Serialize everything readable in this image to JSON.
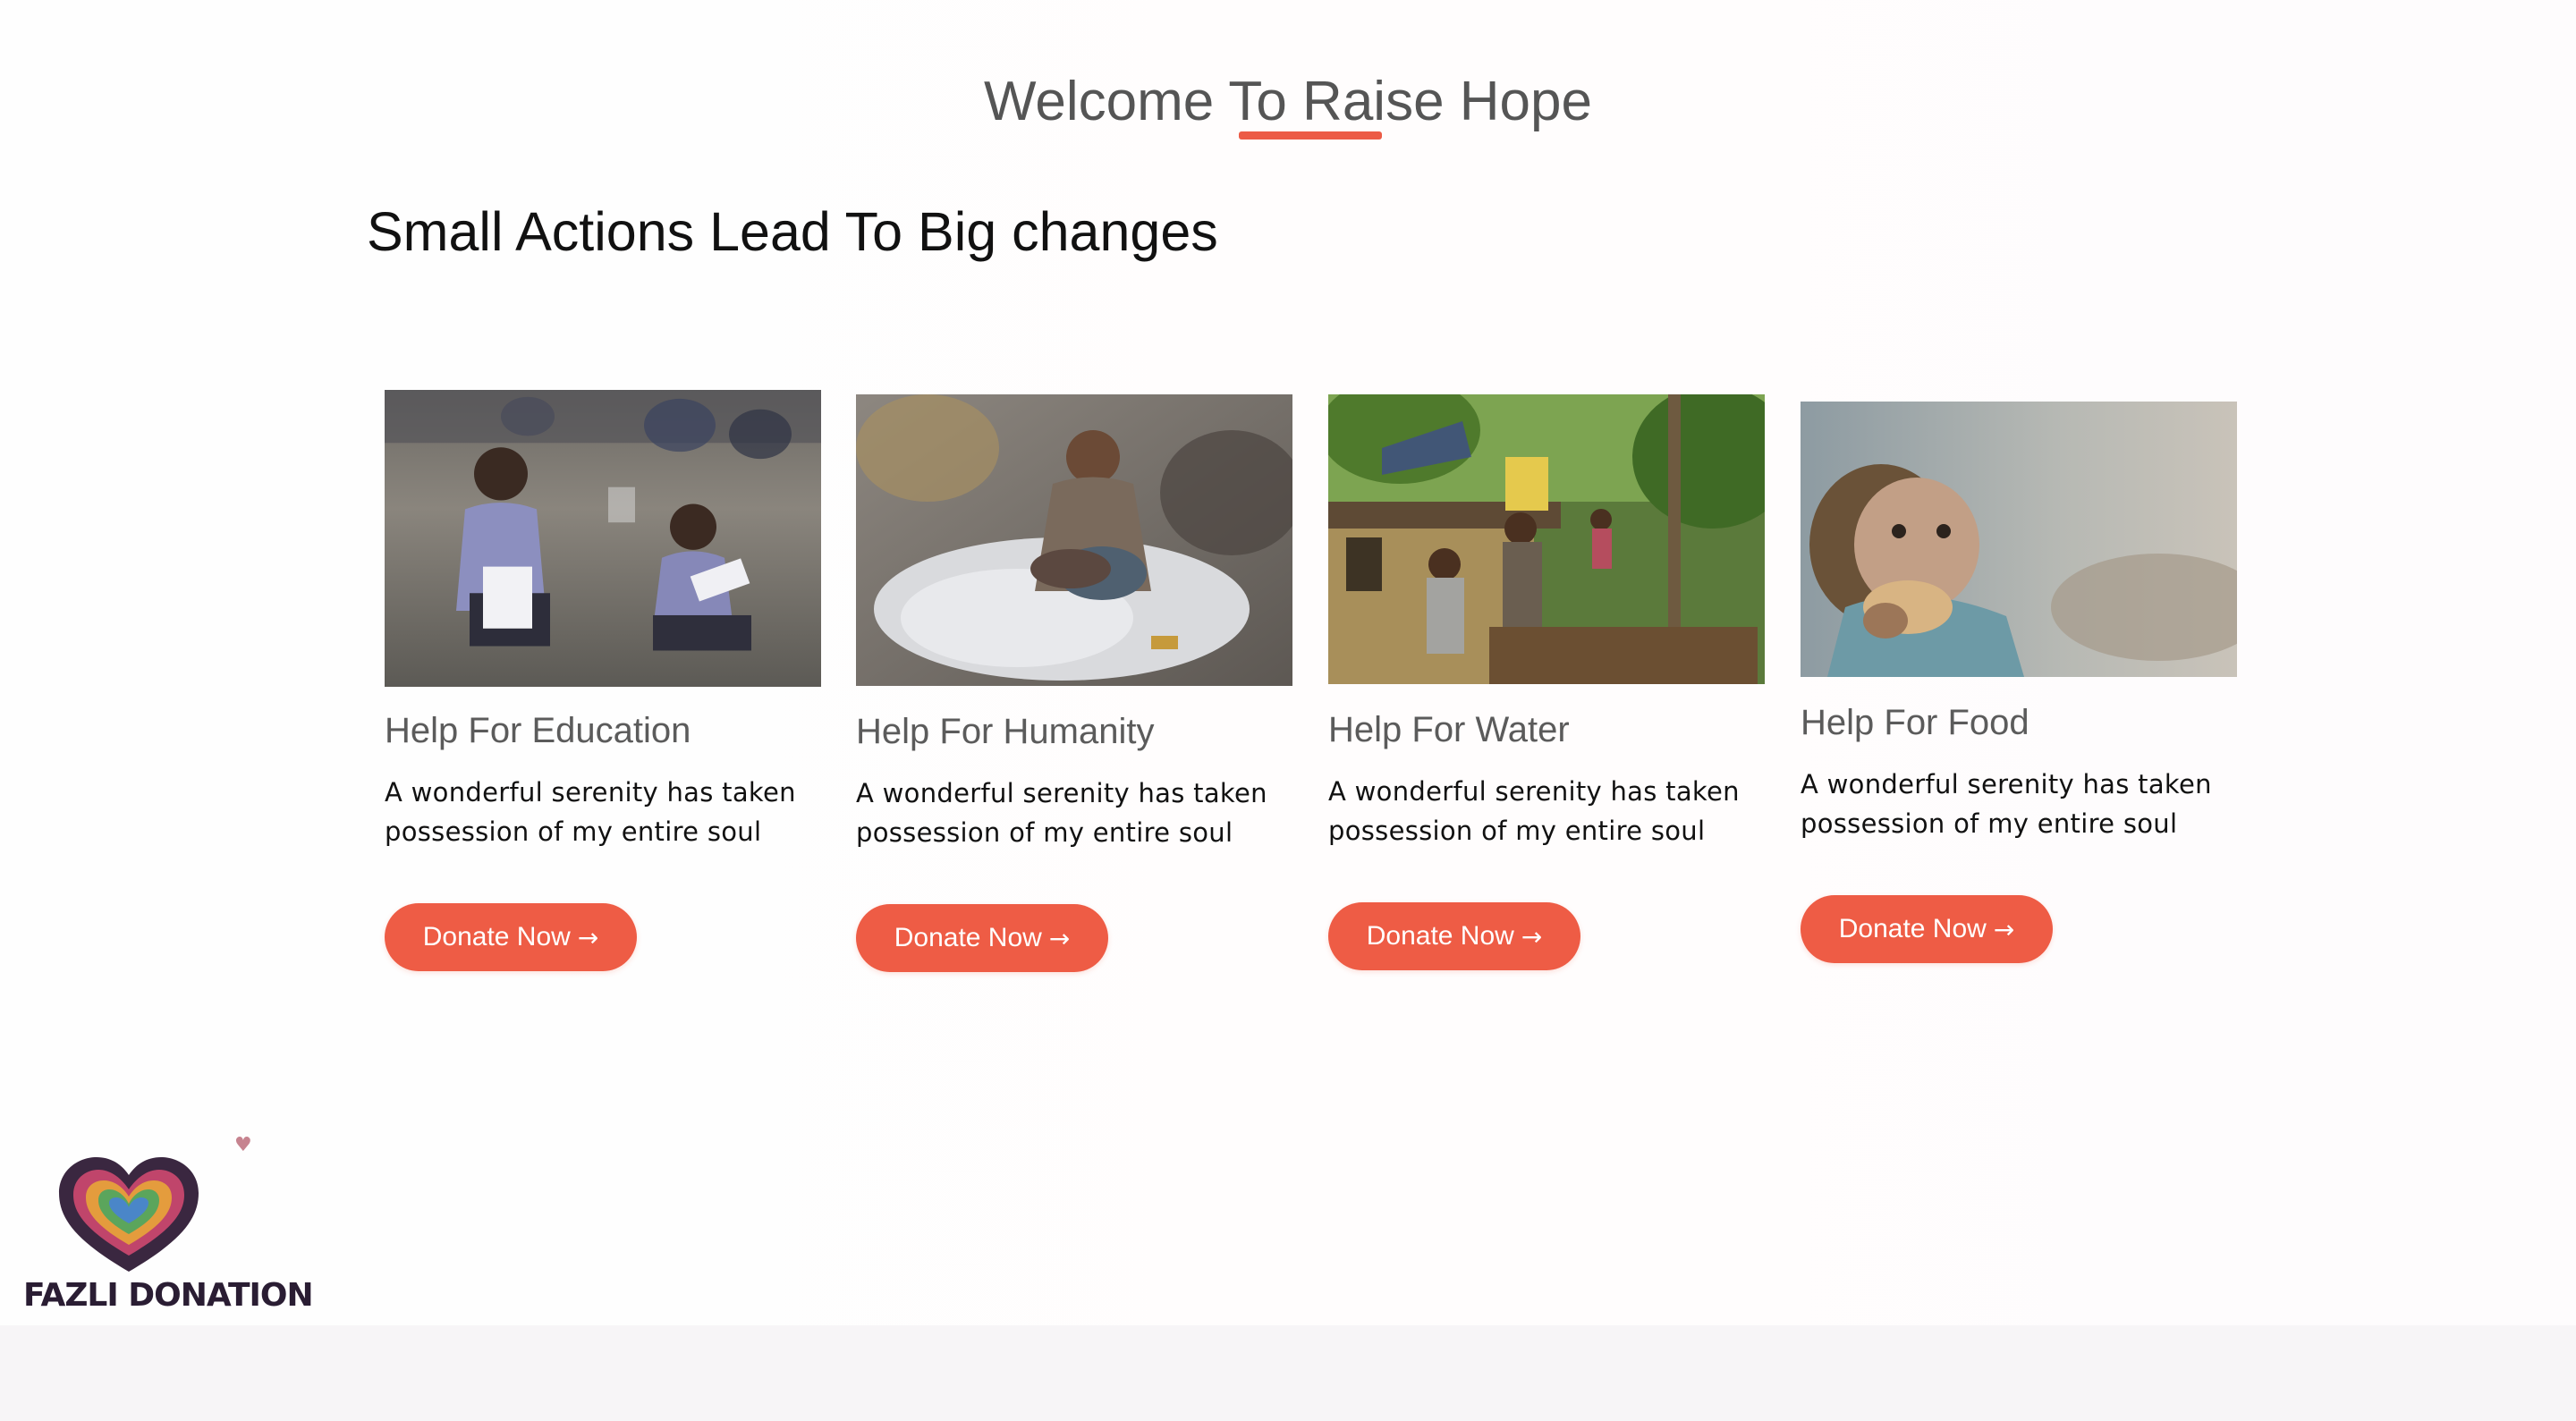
{
  "header": {
    "title": "Welcome To Raise Hope",
    "subtitle": "Small Actions Lead To Big changes",
    "accent_color": "#ec5b46"
  },
  "cards": [
    {
      "title": "Help For Education",
      "text": "A wonderful serenity has taken possession of my entire soul",
      "button_label": "Donate Now",
      "button_icon": "arrow-right-icon",
      "image": "children-studying-on-ground-photo"
    },
    {
      "title": "Help For Humanity",
      "text": "A wonderful serenity has taken possession of my entire soul",
      "button_label": "Donate Now",
      "button_icon": "arrow-right-icon",
      "image": "children-resting-on-sacks-photo"
    },
    {
      "title": "Help For Water",
      "text": "A wonderful serenity has taken possession of my entire soul",
      "button_label": "Donate Now",
      "button_icon": "arrow-right-icon",
      "image": "children-carrying-water-photo"
    },
    {
      "title": "Help For Food",
      "text": "A wonderful serenity has taken possession of my entire soul",
      "button_label": "Donate Now",
      "button_icon": "arrow-right-icon",
      "image": "child-eating-bread-photo"
    }
  ],
  "logo": {
    "text": "FAZLI DONATION",
    "icon": "heart-logo-icon"
  },
  "colors": {
    "button": "#ee5c45",
    "button_text": "#ffffff",
    "heading": "#555555"
  }
}
